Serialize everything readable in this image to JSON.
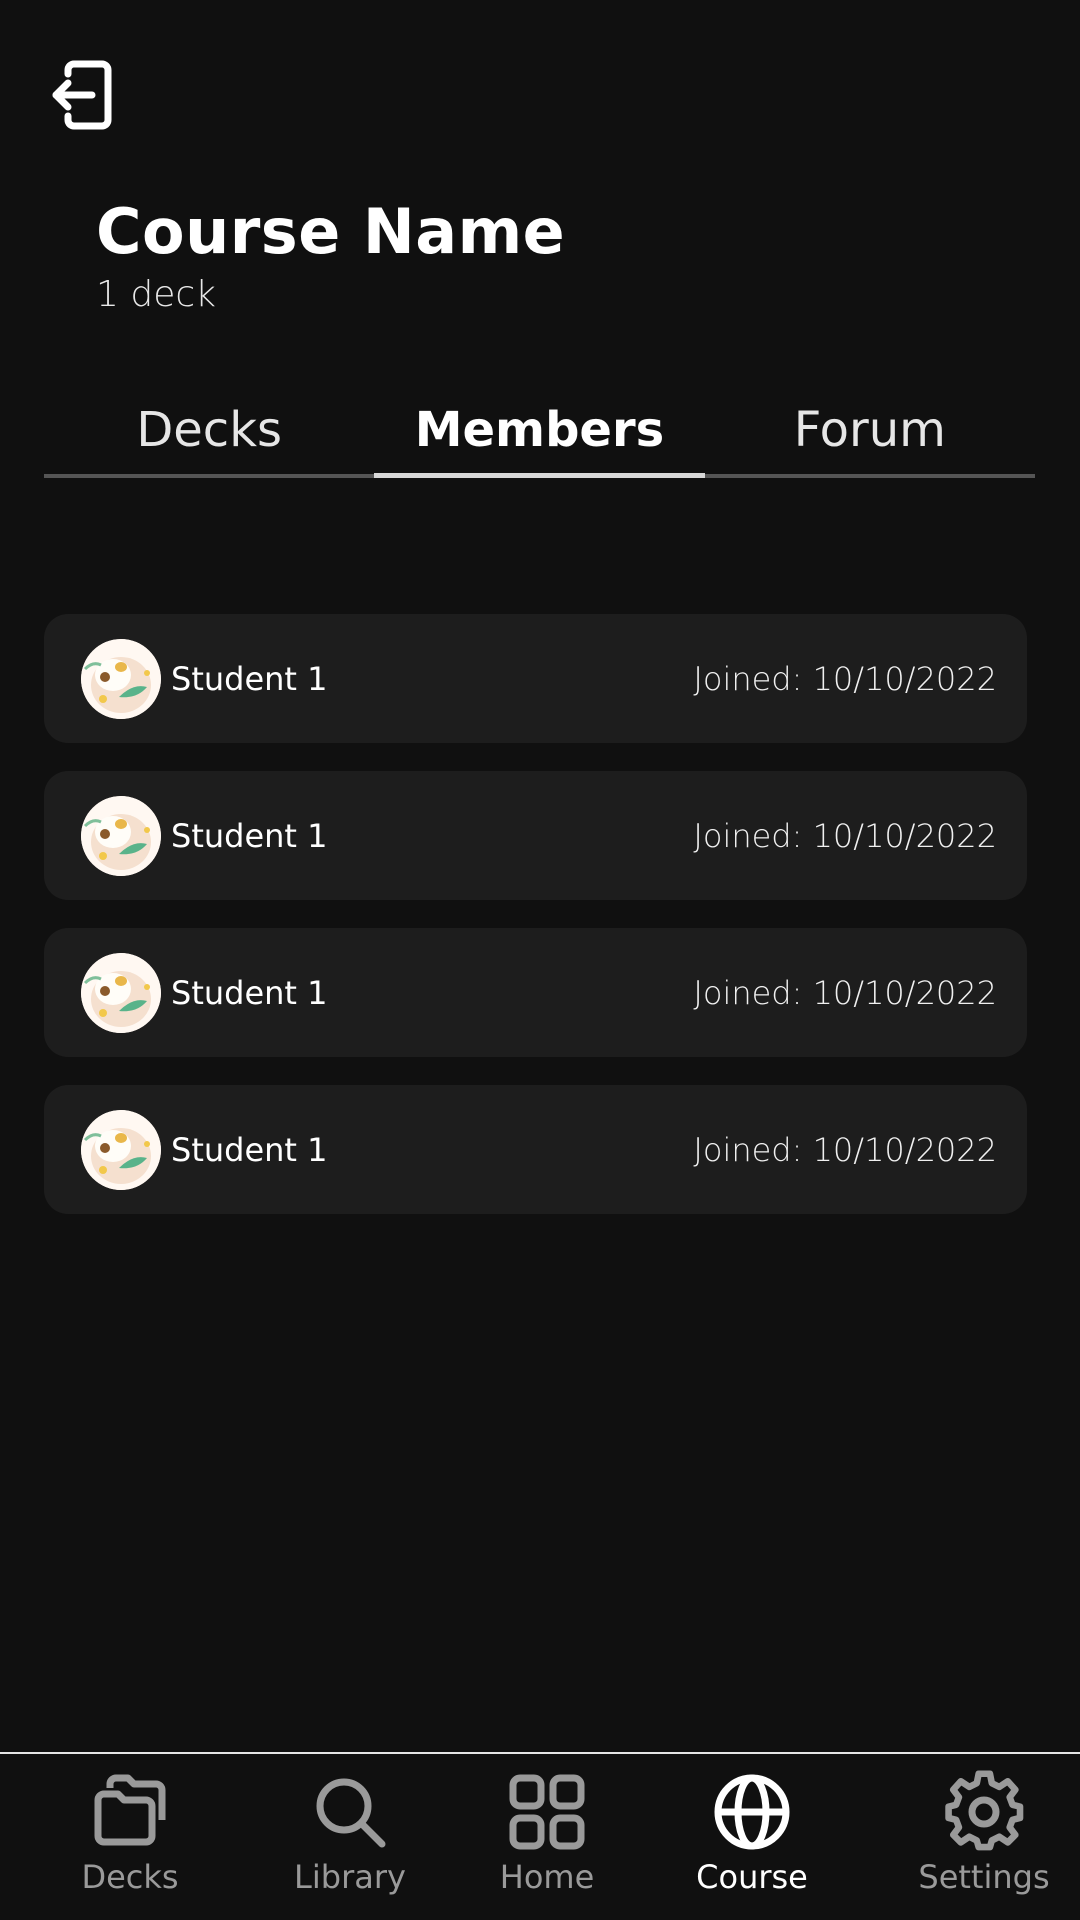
{
  "header": {
    "title": "Course Name",
    "subtitle": "1 deck"
  },
  "tabs": [
    {
      "label": "Decks",
      "active": false
    },
    {
      "label": "Members",
      "active": true
    },
    {
      "label": "Forum",
      "active": false
    }
  ],
  "members": [
    {
      "name": "Student 1",
      "joined": "Joined: 10/10/2022"
    },
    {
      "name": "Student 1",
      "joined": "Joined: 10/10/2022"
    },
    {
      "name": "Student 1",
      "joined": "Joined: 10/10/2022"
    },
    {
      "name": "Student 1",
      "joined": "Joined: 10/10/2022"
    }
  ],
  "nav": [
    {
      "label": "Decks",
      "icon": "folder-icon",
      "active": false
    },
    {
      "label": "Library",
      "icon": "search-icon",
      "active": false
    },
    {
      "label": "Home",
      "icon": "grid-icon",
      "active": false
    },
    {
      "label": "Course",
      "icon": "globe-icon",
      "active": true
    },
    {
      "label": "Settings",
      "icon": "gear-icon",
      "active": false
    }
  ],
  "colors": {
    "background": "#101010",
    "card": "#1d1d1d",
    "active_text": "#ffffff",
    "inactive_text": "#9a9a9a"
  }
}
